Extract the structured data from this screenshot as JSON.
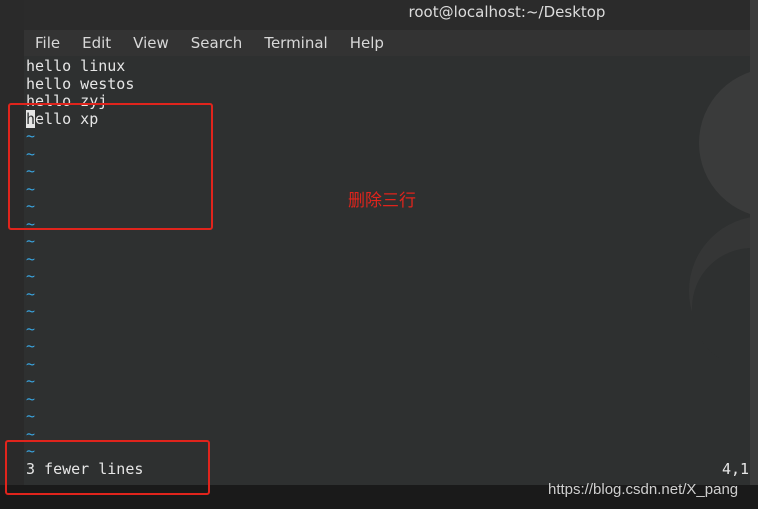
{
  "window": {
    "title": "root@localhost:~/Desktop"
  },
  "menubar": {
    "items": [
      "File",
      "Edit",
      "View",
      "Search",
      "Terminal",
      "Help"
    ]
  },
  "editor": {
    "lines": [
      {
        "text": "hello linux"
      },
      {
        "text": "hello westos"
      },
      {
        "text": "hello zyj"
      },
      {
        "cursor_char": "h",
        "text": "ello xp"
      }
    ],
    "tilde_char": "~",
    "status_message": "3 fewer lines",
    "cursor_position": "4,1"
  },
  "annotations": {
    "note": "删除三行",
    "watermark": "https://blog.csdn.net/X_pang"
  },
  "colors": {
    "terminal_bg": "#2e3030",
    "text": "#e6e6e6",
    "tilde": "#3aa5e0",
    "annotation_red": "#e0241c"
  }
}
